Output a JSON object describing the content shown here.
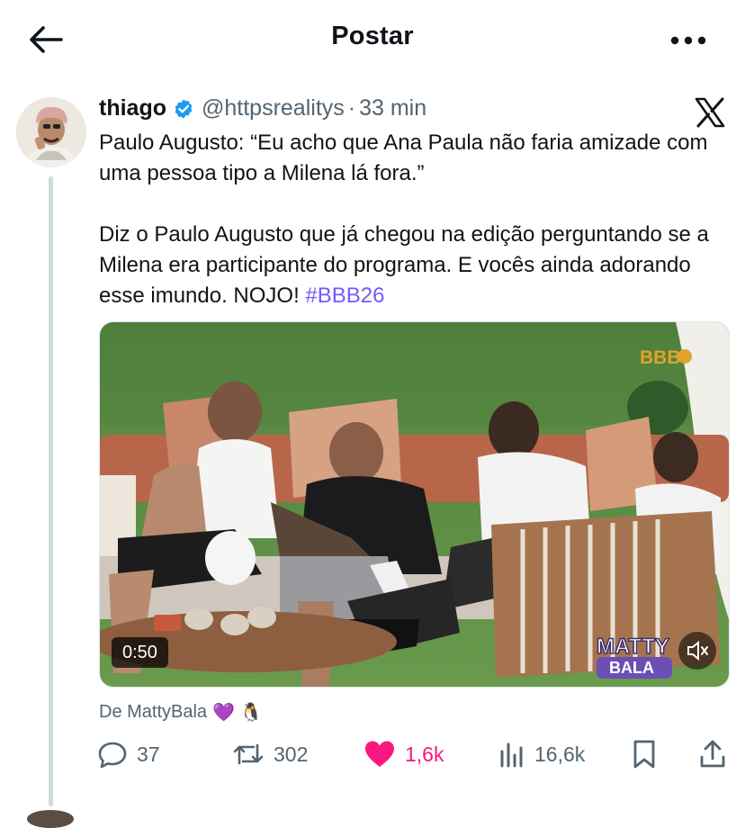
{
  "header": {
    "title": "Postar"
  },
  "tweet": {
    "author_name": "thiago",
    "handle": "@httpsrealitys",
    "separator": "·",
    "time": "33 min",
    "text_p1": "Paulo Augusto: “Eu acho que Ana Paula não faria amizade com uma pessoa tipo a Milena lá fora.”",
    "text_p2": "Diz o Paulo Augusto que já chegou na edição perguntando se a Milena era participante do programa. E vocês ainda adorando esse imundo. NOJO!",
    "hashtag": "#BBB26",
    "video_duration": "0:50",
    "video_brand_top": "BBB",
    "video_watermark_line1": "MATTY",
    "video_watermark_line2": "BALA",
    "credit_text": "De MattyBala",
    "credit_emoji": "💜 🐧"
  },
  "actions": {
    "replies": "37",
    "reposts": "302",
    "likes": "1,6k",
    "views": "16,6k"
  },
  "colors": {
    "accent": "#7856ff",
    "like": "#f91880",
    "verified": "#1d9bf0",
    "muted": "#536471"
  },
  "icons": [
    "back-arrow-icon",
    "more-icon",
    "verified-icon",
    "x-logo-icon",
    "reply-icon",
    "repost-icon",
    "like-icon",
    "views-icon",
    "bookmark-icon",
    "share-icon",
    "mute-icon"
  ]
}
